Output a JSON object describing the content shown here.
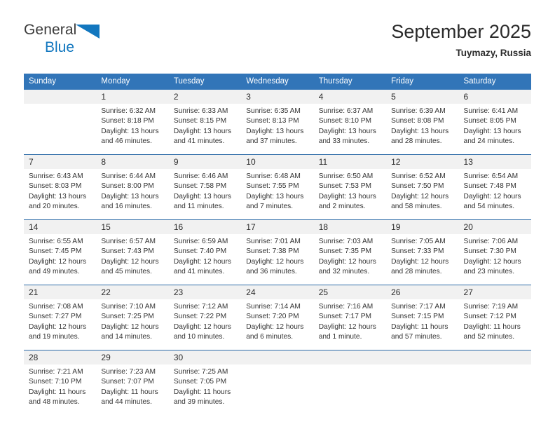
{
  "brand": {
    "name_top": "General",
    "name_bottom": "Blue",
    "triangle_color": "#1277bf"
  },
  "header": {
    "title": "September 2025",
    "subtitle": "Tuymazy, Russia"
  },
  "colors": {
    "header_blue": "#3275b8",
    "row_separator_blue": "#2e6ca8",
    "daynum_band": "#f1f1f1",
    "text": "#333333"
  },
  "calendar": {
    "weekday_headers": [
      "Sunday",
      "Monday",
      "Tuesday",
      "Wednesday",
      "Thursday",
      "Friday",
      "Saturday"
    ],
    "labels": {
      "sunrise_prefix": "Sunrise:",
      "sunset_prefix": "Sunset:",
      "daylight_prefix": "Daylight:"
    },
    "weeks": [
      [
        {
          "day": "",
          "empty": true
        },
        {
          "day": "1",
          "sunrise": "Sunrise: 6:32 AM",
          "sunset": "Sunset: 8:18 PM",
          "daylight": "Daylight: 13 hours and 46 minutes."
        },
        {
          "day": "2",
          "sunrise": "Sunrise: 6:33 AM",
          "sunset": "Sunset: 8:15 PM",
          "daylight": "Daylight: 13 hours and 41 minutes."
        },
        {
          "day": "3",
          "sunrise": "Sunrise: 6:35 AM",
          "sunset": "Sunset: 8:13 PM",
          "daylight": "Daylight: 13 hours and 37 minutes."
        },
        {
          "day": "4",
          "sunrise": "Sunrise: 6:37 AM",
          "sunset": "Sunset: 8:10 PM",
          "daylight": "Daylight: 13 hours and 33 minutes."
        },
        {
          "day": "5",
          "sunrise": "Sunrise: 6:39 AM",
          "sunset": "Sunset: 8:08 PM",
          "daylight": "Daylight: 13 hours and 28 minutes."
        },
        {
          "day": "6",
          "sunrise": "Sunrise: 6:41 AM",
          "sunset": "Sunset: 8:05 PM",
          "daylight": "Daylight: 13 hours and 24 minutes."
        }
      ],
      [
        {
          "day": "7",
          "sunrise": "Sunrise: 6:43 AM",
          "sunset": "Sunset: 8:03 PM",
          "daylight": "Daylight: 13 hours and 20 minutes."
        },
        {
          "day": "8",
          "sunrise": "Sunrise: 6:44 AM",
          "sunset": "Sunset: 8:00 PM",
          "daylight": "Daylight: 13 hours and 16 minutes."
        },
        {
          "day": "9",
          "sunrise": "Sunrise: 6:46 AM",
          "sunset": "Sunset: 7:58 PM",
          "daylight": "Daylight: 13 hours and 11 minutes."
        },
        {
          "day": "10",
          "sunrise": "Sunrise: 6:48 AM",
          "sunset": "Sunset: 7:55 PM",
          "daylight": "Daylight: 13 hours and 7 minutes."
        },
        {
          "day": "11",
          "sunrise": "Sunrise: 6:50 AM",
          "sunset": "Sunset: 7:53 PM",
          "daylight": "Daylight: 13 hours and 2 minutes."
        },
        {
          "day": "12",
          "sunrise": "Sunrise: 6:52 AM",
          "sunset": "Sunset: 7:50 PM",
          "daylight": "Daylight: 12 hours and 58 minutes."
        },
        {
          "day": "13",
          "sunrise": "Sunrise: 6:54 AM",
          "sunset": "Sunset: 7:48 PM",
          "daylight": "Daylight: 12 hours and 54 minutes."
        }
      ],
      [
        {
          "day": "14",
          "sunrise": "Sunrise: 6:55 AM",
          "sunset": "Sunset: 7:45 PM",
          "daylight": "Daylight: 12 hours and 49 minutes."
        },
        {
          "day": "15",
          "sunrise": "Sunrise: 6:57 AM",
          "sunset": "Sunset: 7:43 PM",
          "daylight": "Daylight: 12 hours and 45 minutes."
        },
        {
          "day": "16",
          "sunrise": "Sunrise: 6:59 AM",
          "sunset": "Sunset: 7:40 PM",
          "daylight": "Daylight: 12 hours and 41 minutes."
        },
        {
          "day": "17",
          "sunrise": "Sunrise: 7:01 AM",
          "sunset": "Sunset: 7:38 PM",
          "daylight": "Daylight: 12 hours and 36 minutes."
        },
        {
          "day": "18",
          "sunrise": "Sunrise: 7:03 AM",
          "sunset": "Sunset: 7:35 PM",
          "daylight": "Daylight: 12 hours and 32 minutes."
        },
        {
          "day": "19",
          "sunrise": "Sunrise: 7:05 AM",
          "sunset": "Sunset: 7:33 PM",
          "daylight": "Daylight: 12 hours and 28 minutes."
        },
        {
          "day": "20",
          "sunrise": "Sunrise: 7:06 AM",
          "sunset": "Sunset: 7:30 PM",
          "daylight": "Daylight: 12 hours and 23 minutes."
        }
      ],
      [
        {
          "day": "21",
          "sunrise": "Sunrise: 7:08 AM",
          "sunset": "Sunset: 7:27 PM",
          "daylight": "Daylight: 12 hours and 19 minutes."
        },
        {
          "day": "22",
          "sunrise": "Sunrise: 7:10 AM",
          "sunset": "Sunset: 7:25 PM",
          "daylight": "Daylight: 12 hours and 14 minutes."
        },
        {
          "day": "23",
          "sunrise": "Sunrise: 7:12 AM",
          "sunset": "Sunset: 7:22 PM",
          "daylight": "Daylight: 12 hours and 10 minutes."
        },
        {
          "day": "24",
          "sunrise": "Sunrise: 7:14 AM",
          "sunset": "Sunset: 7:20 PM",
          "daylight": "Daylight: 12 hours and 6 minutes."
        },
        {
          "day": "25",
          "sunrise": "Sunrise: 7:16 AM",
          "sunset": "Sunset: 7:17 PM",
          "daylight": "Daylight: 12 hours and 1 minute."
        },
        {
          "day": "26",
          "sunrise": "Sunrise: 7:17 AM",
          "sunset": "Sunset: 7:15 PM",
          "daylight": "Daylight: 11 hours and 57 minutes."
        },
        {
          "day": "27",
          "sunrise": "Sunrise: 7:19 AM",
          "sunset": "Sunset: 7:12 PM",
          "daylight": "Daylight: 11 hours and 52 minutes."
        }
      ],
      [
        {
          "day": "28",
          "sunrise": "Sunrise: 7:21 AM",
          "sunset": "Sunset: 7:10 PM",
          "daylight": "Daylight: 11 hours and 48 minutes."
        },
        {
          "day": "29",
          "sunrise": "Sunrise: 7:23 AM",
          "sunset": "Sunset: 7:07 PM",
          "daylight": "Daylight: 11 hours and 44 minutes."
        },
        {
          "day": "30",
          "sunrise": "Sunrise: 7:25 AM",
          "sunset": "Sunset: 7:05 PM",
          "daylight": "Daylight: 11 hours and 39 minutes."
        },
        {
          "day": "",
          "empty": true
        },
        {
          "day": "",
          "empty": true
        },
        {
          "day": "",
          "empty": true
        },
        {
          "day": "",
          "empty": true
        }
      ]
    ]
  }
}
